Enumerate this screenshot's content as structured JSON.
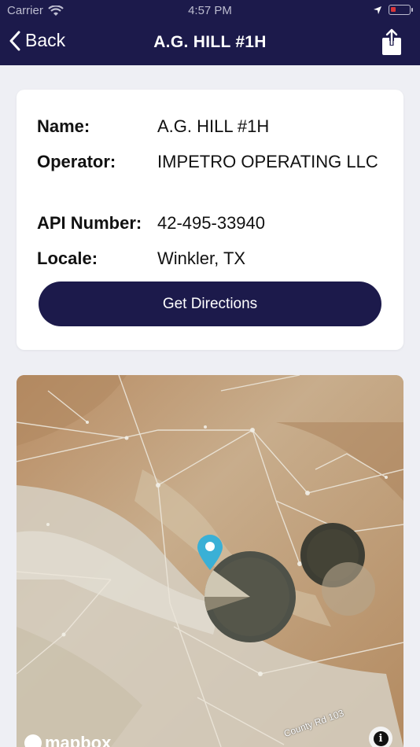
{
  "status_bar": {
    "carrier": "Carrier",
    "time": "4:57 PM",
    "icons": [
      "wifi-icon",
      "location-arrow-icon",
      "battery-icon"
    ]
  },
  "nav": {
    "back_label": "Back",
    "title": "A.G. HILL #1H",
    "icons": [
      "chevron-left-icon",
      "share-icon"
    ],
    "background_color": "#1c1a4b"
  },
  "details": {
    "name_label": "Name:",
    "name_value": "A.G. HILL #1H",
    "operator_label": "Operator:",
    "operator_value": "IMPETRO OPERATING LLC",
    "api_label": "API Number:",
    "api_value": "42-495-33940",
    "locale_label": "Locale:",
    "locale_value": "Winkler, TX",
    "directions_label": "Get Directions"
  },
  "map": {
    "attribution": "mapbox",
    "road_label": "County Rd 103",
    "info_glyph": "i",
    "pin_color": "#3ab0d6",
    "icons": [
      "map-pin-icon",
      "mapbox-logo-icon",
      "info-icon"
    ]
  }
}
